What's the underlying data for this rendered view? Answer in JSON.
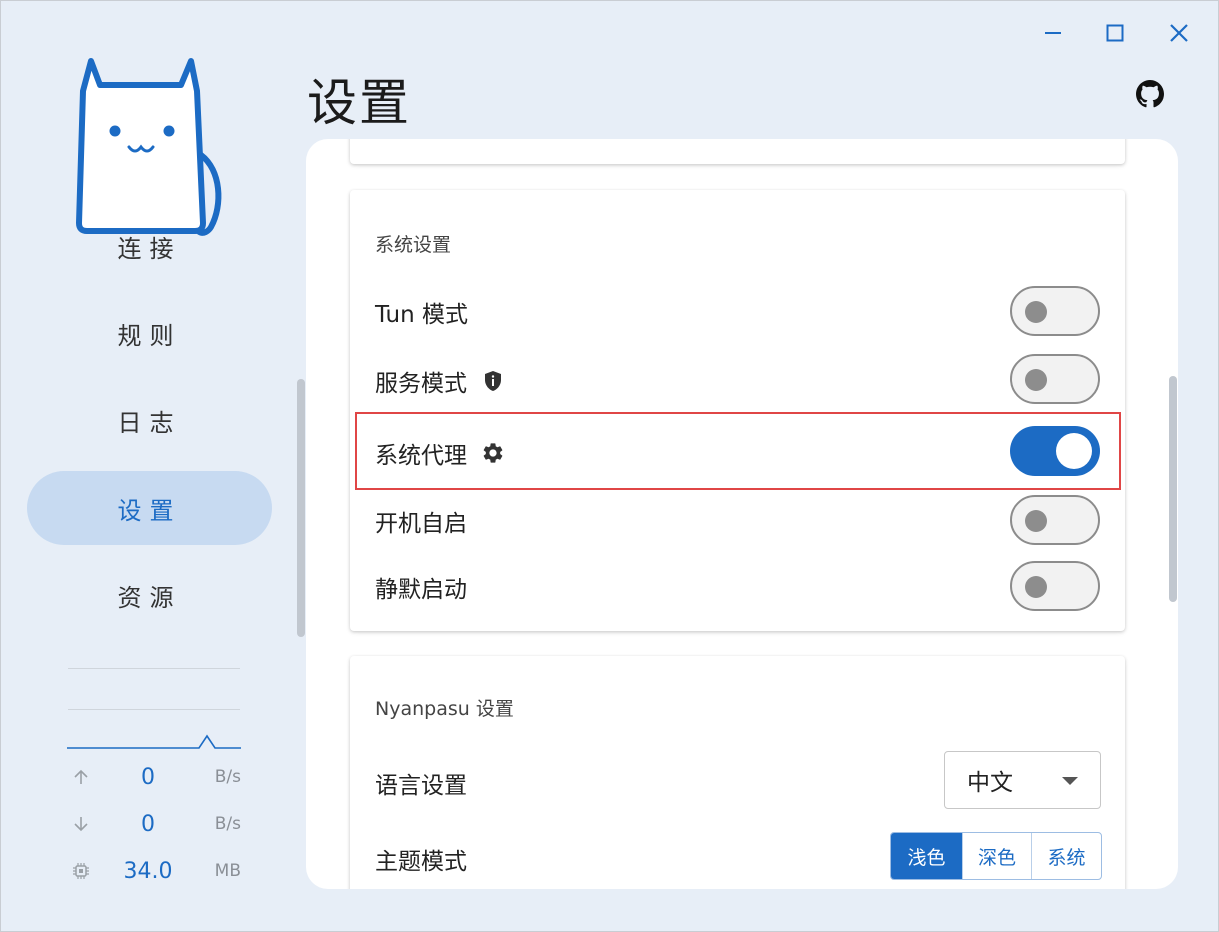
{
  "window": {
    "controls": [
      "minimize",
      "maximize",
      "close"
    ]
  },
  "sidebar": {
    "nav": [
      {
        "label": "连接",
        "active": false
      },
      {
        "label": "规则",
        "active": false
      },
      {
        "label": "日志",
        "active": false
      },
      {
        "label": "设置",
        "active": true
      },
      {
        "label": "资源",
        "active": false
      }
    ],
    "traffic": {
      "upload": {
        "value": "0",
        "unit": "B/s"
      },
      "download": {
        "value": "0",
        "unit": "B/s"
      },
      "memory": {
        "value": "34.0",
        "unit": "MB"
      }
    }
  },
  "header": {
    "title": "设置",
    "github_icon": "github-icon"
  },
  "system_settings": {
    "title": "系统设置",
    "rows": [
      {
        "label": "Tun 模式",
        "enabled": false
      },
      {
        "label": "服务模式",
        "icon": "shield-info-icon",
        "enabled": false
      },
      {
        "label": "系统代理",
        "icon": "gear-icon",
        "enabled": true
      },
      {
        "label": "开机自启",
        "enabled": false
      },
      {
        "label": "静默启动",
        "enabled": false
      }
    ]
  },
  "nyanpasu_settings": {
    "title": "Nyanpasu 设置",
    "language": {
      "label": "语言设置",
      "value": "中文"
    },
    "theme": {
      "label": "主题模式",
      "options": [
        "浅色",
        "深色",
        "系统"
      ],
      "selected": "浅色"
    }
  },
  "colors": {
    "accent": "#1c6bc4",
    "background": "#e7eef7",
    "highlight_border": "#e04646"
  }
}
